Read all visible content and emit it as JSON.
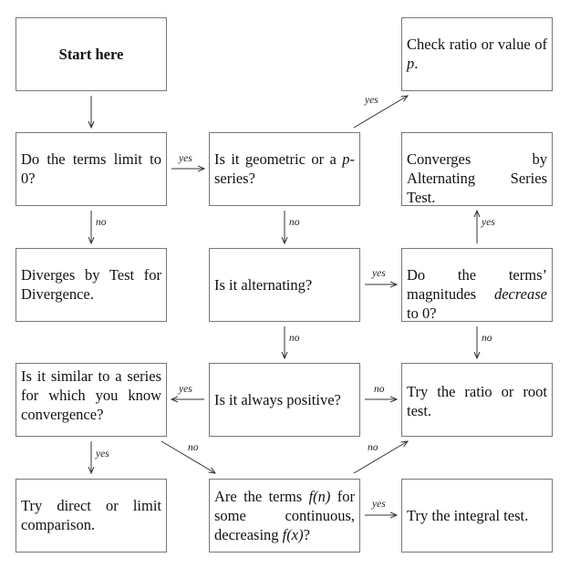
{
  "nodes": {
    "start": {
      "text": "Start here"
    },
    "limit_zero": {
      "text": "Do the terms limit to 0?"
    },
    "geometric": {
      "text_a": "Is it geometric or a ",
      "var": "p",
      "text_b": "-series?"
    },
    "check_ratio": {
      "text_a": "Check ratio or value of ",
      "var": "p",
      "text_b": "."
    },
    "diverges": {
      "text": "Diverges by Test for Divergence."
    },
    "alternating": {
      "text": "Is it alternating?"
    },
    "converges_ast": {
      "text": "Converges by Alternating Series Test."
    },
    "magnitudes": {
      "text_a": "Do the terms’ magnitudes ",
      "em": "decrease",
      "text_b": " to 0?"
    },
    "similar": {
      "text": "Is it similar to a series for which you know convergence?"
    },
    "positive": {
      "text": "Is it always positive?"
    },
    "ratio_root": {
      "text": "Try the ratio or root test."
    },
    "comparison": {
      "text": "Try direct or limit comparison."
    },
    "integral_q": {
      "text_a": "Are the terms ",
      "fn": "f(n)",
      "text_b": " for some continuous, decreasing ",
      "fx": "f(x)",
      "text_c": "?"
    },
    "integral_test": {
      "text": "Try the integral test."
    }
  },
  "edges": {
    "start_to_limit": "",
    "limit_yes": "yes",
    "limit_no": "no",
    "geometric_yes": "yes",
    "geometric_no": "no",
    "alternating_yes": "yes",
    "alternating_no": "no",
    "magnitudes_yes": "yes",
    "magnitudes_no": "no",
    "positive_yes": "yes",
    "positive_no": "no",
    "similar_yes": "yes",
    "similar_no": "no",
    "integral_yes": "yes",
    "integral_no": "no"
  },
  "colors": {
    "border": "#777777",
    "arrow": "#333333",
    "text": "#111111"
  }
}
